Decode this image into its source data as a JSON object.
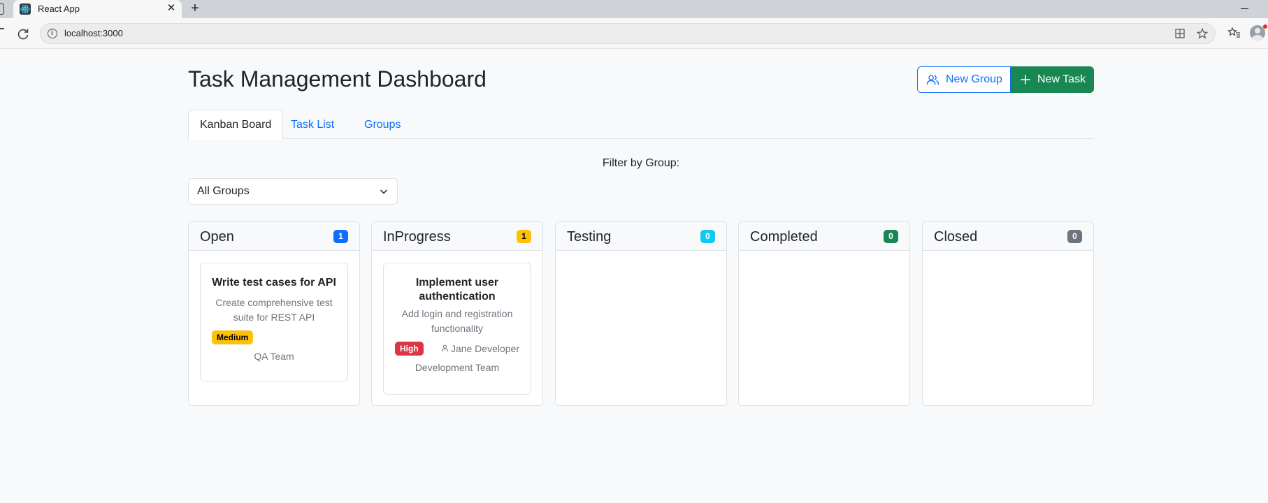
{
  "browser": {
    "tab_title": "React App",
    "tab_close": "✕",
    "new_tab": "+",
    "url": "localhost:3000"
  },
  "page": {
    "title": "Task Management Dashboard",
    "new_group_label": "New Group",
    "new_task_label": "New Task"
  },
  "tabs": [
    {
      "label": "Kanban Board",
      "active": true
    },
    {
      "label": "Task List",
      "active": false
    },
    {
      "label": "Groups",
      "active": false
    }
  ],
  "filter": {
    "label": "Filter by Group:",
    "selected": "All Groups"
  },
  "columns": [
    {
      "title": "Open",
      "count": "1",
      "badge_color": "#0d6efd",
      "badge_text": "#ffffff"
    },
    {
      "title": "InProgress",
      "count": "1",
      "badge_color": "#ffc107",
      "badge_text": "#000000"
    },
    {
      "title": "Testing",
      "count": "0",
      "badge_color": "#0dcaf0",
      "badge_text": "#ffffff"
    },
    {
      "title": "Completed",
      "count": "0",
      "badge_color": "#198754",
      "badge_text": "#ffffff"
    },
    {
      "title": "Closed",
      "count": "0",
      "badge_color": "#6c757d",
      "badge_text": "#ffffff"
    }
  ],
  "tasks": {
    "open": {
      "title": "Write test cases for API",
      "description": "Create comprehensive test suite for REST API",
      "priority": "Medium",
      "priority_color": "#ffc107",
      "group": "QA Team"
    },
    "inprogress": {
      "title": "Implement user authentication",
      "description": "Add login and registration functionality",
      "priority": "High",
      "priority_color": "#dc3545",
      "assignee": "Jane Developer",
      "group": "Development Team"
    }
  }
}
